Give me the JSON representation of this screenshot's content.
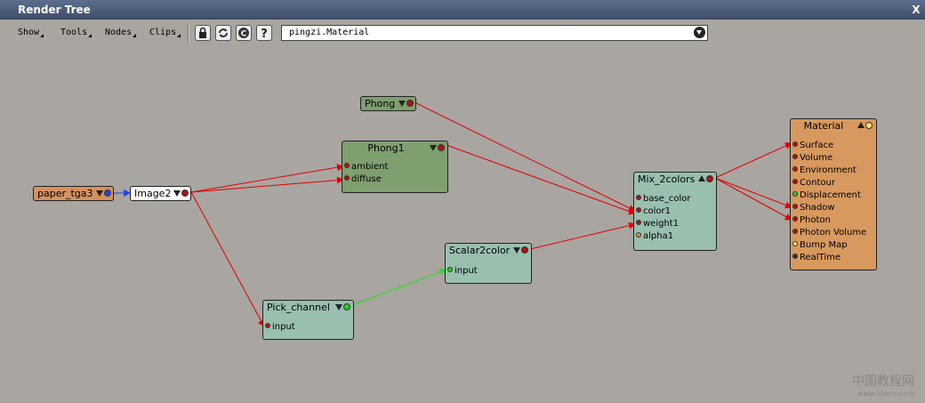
{
  "window": {
    "title": "Render Tree",
    "close_label": "X"
  },
  "toolbar": {
    "menus": [
      "Show",
      "Tools",
      "Nodes",
      "Clips"
    ],
    "icons": [
      "lock-icon",
      "refresh-icon",
      "c-icon",
      "help-icon"
    ],
    "help_label": "?",
    "c_label": "C",
    "selector_value": "pingzi.Material"
  },
  "nodes": {
    "paper": {
      "title": "paper_tga3",
      "color": "#d8915e"
    },
    "image2": {
      "title": "Image2",
      "color": "#ffffff"
    },
    "phong": {
      "title": "Phong",
      "color": "#7f9f6f"
    },
    "phong1": {
      "title": "Phong1",
      "color": "#7f9f6f",
      "ports": [
        "ambient",
        "diffuse"
      ]
    },
    "pick": {
      "title": "Pick_channel",
      "color": "#99bfaf",
      "ports": [
        "input"
      ]
    },
    "scalar": {
      "title": "Scalar2color",
      "color": "#99bfaf",
      "ports": [
        "input"
      ]
    },
    "mix": {
      "title": "Mix_2colors",
      "color": "#99bfaf",
      "ports": [
        "base_color",
        "color1",
        "weight1",
        "alpha1"
      ]
    },
    "material": {
      "title": "Material",
      "color": "#d8995e",
      "ports": [
        "Surface",
        "Volume",
        "Environment",
        "Contour",
        "Displacement",
        "Shadow",
        "Photon",
        "Photon Volume",
        "Bump Map",
        "RealTime"
      ]
    }
  },
  "watermark": {
    "text": "中国教程网",
    "url": "www.jcwcn.com"
  }
}
